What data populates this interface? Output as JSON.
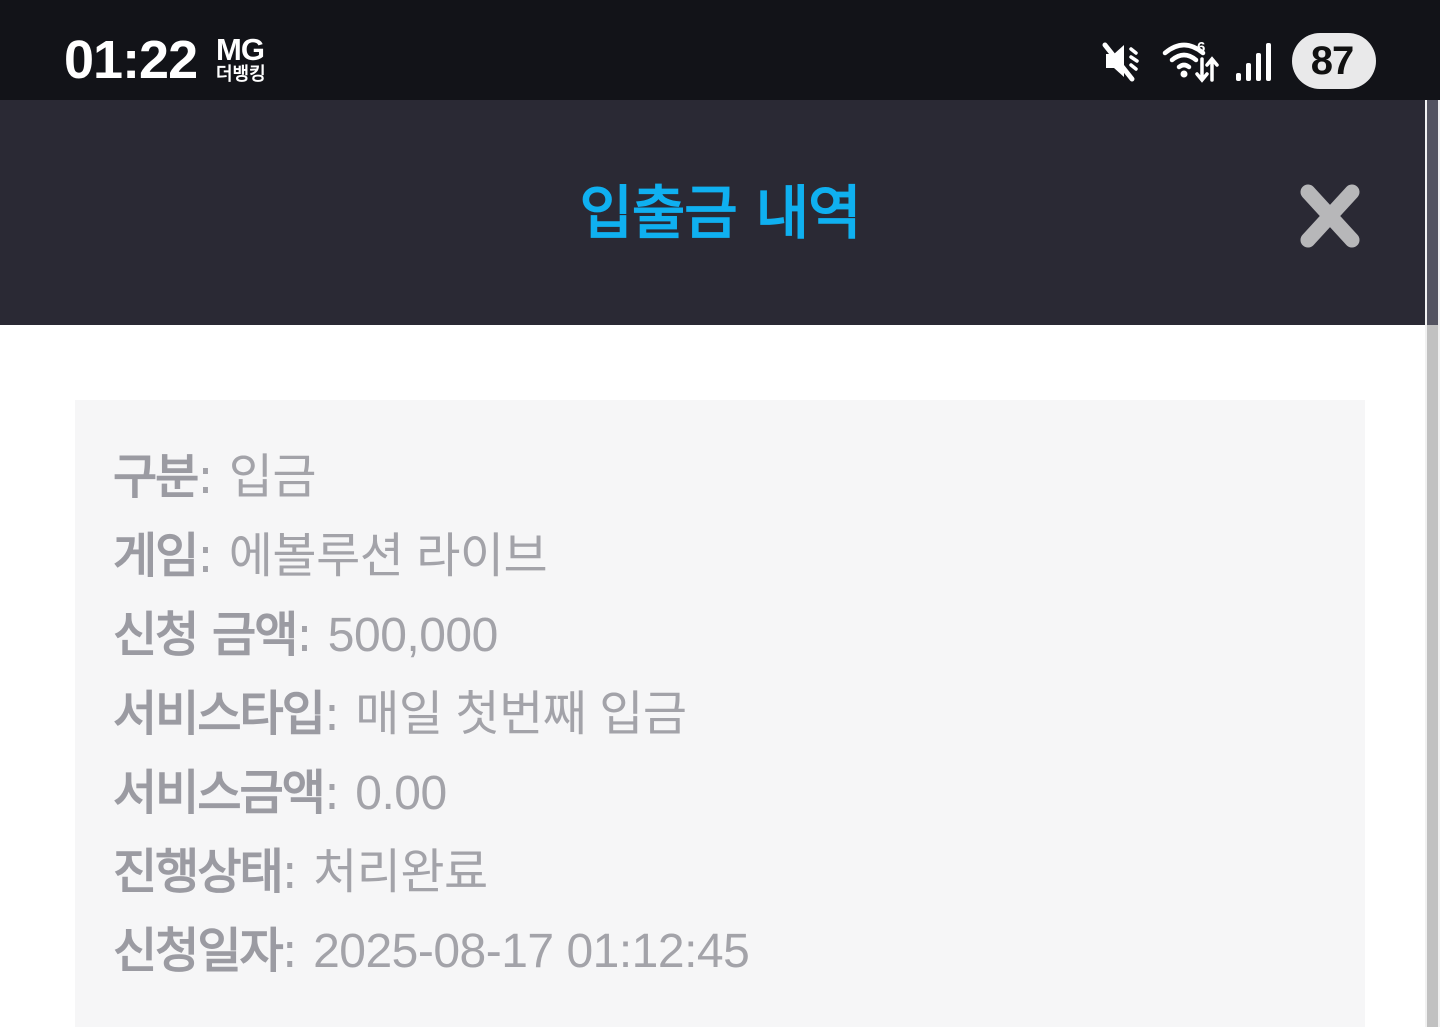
{
  "status_bar": {
    "time": "01:22",
    "carrier_top": "MG",
    "carrier_bottom": "더뱅킹",
    "battery": "87",
    "icons": [
      "mute-icon",
      "wifi-icon",
      "signal-icon"
    ]
  },
  "header": {
    "title": "입출금 내역",
    "title_color": "#0fb0f0",
    "background": "#2a2934",
    "close_icon": "close-icon"
  },
  "details": [
    {
      "label": "구분",
      "value": "입금"
    },
    {
      "label": "게임",
      "value": "에볼루션 라이브"
    },
    {
      "label": "신청 금액",
      "value": "500,000"
    },
    {
      "label": "서비스타입",
      "value": "매일 첫번째 입금"
    },
    {
      "label": "서비스금액",
      "value": "0.00"
    },
    {
      "label": "진행상태",
      "value": "처리완료"
    },
    {
      "label": "신청일자",
      "value": "2025-08-17 01:12:45"
    }
  ],
  "colon": ":"
}
